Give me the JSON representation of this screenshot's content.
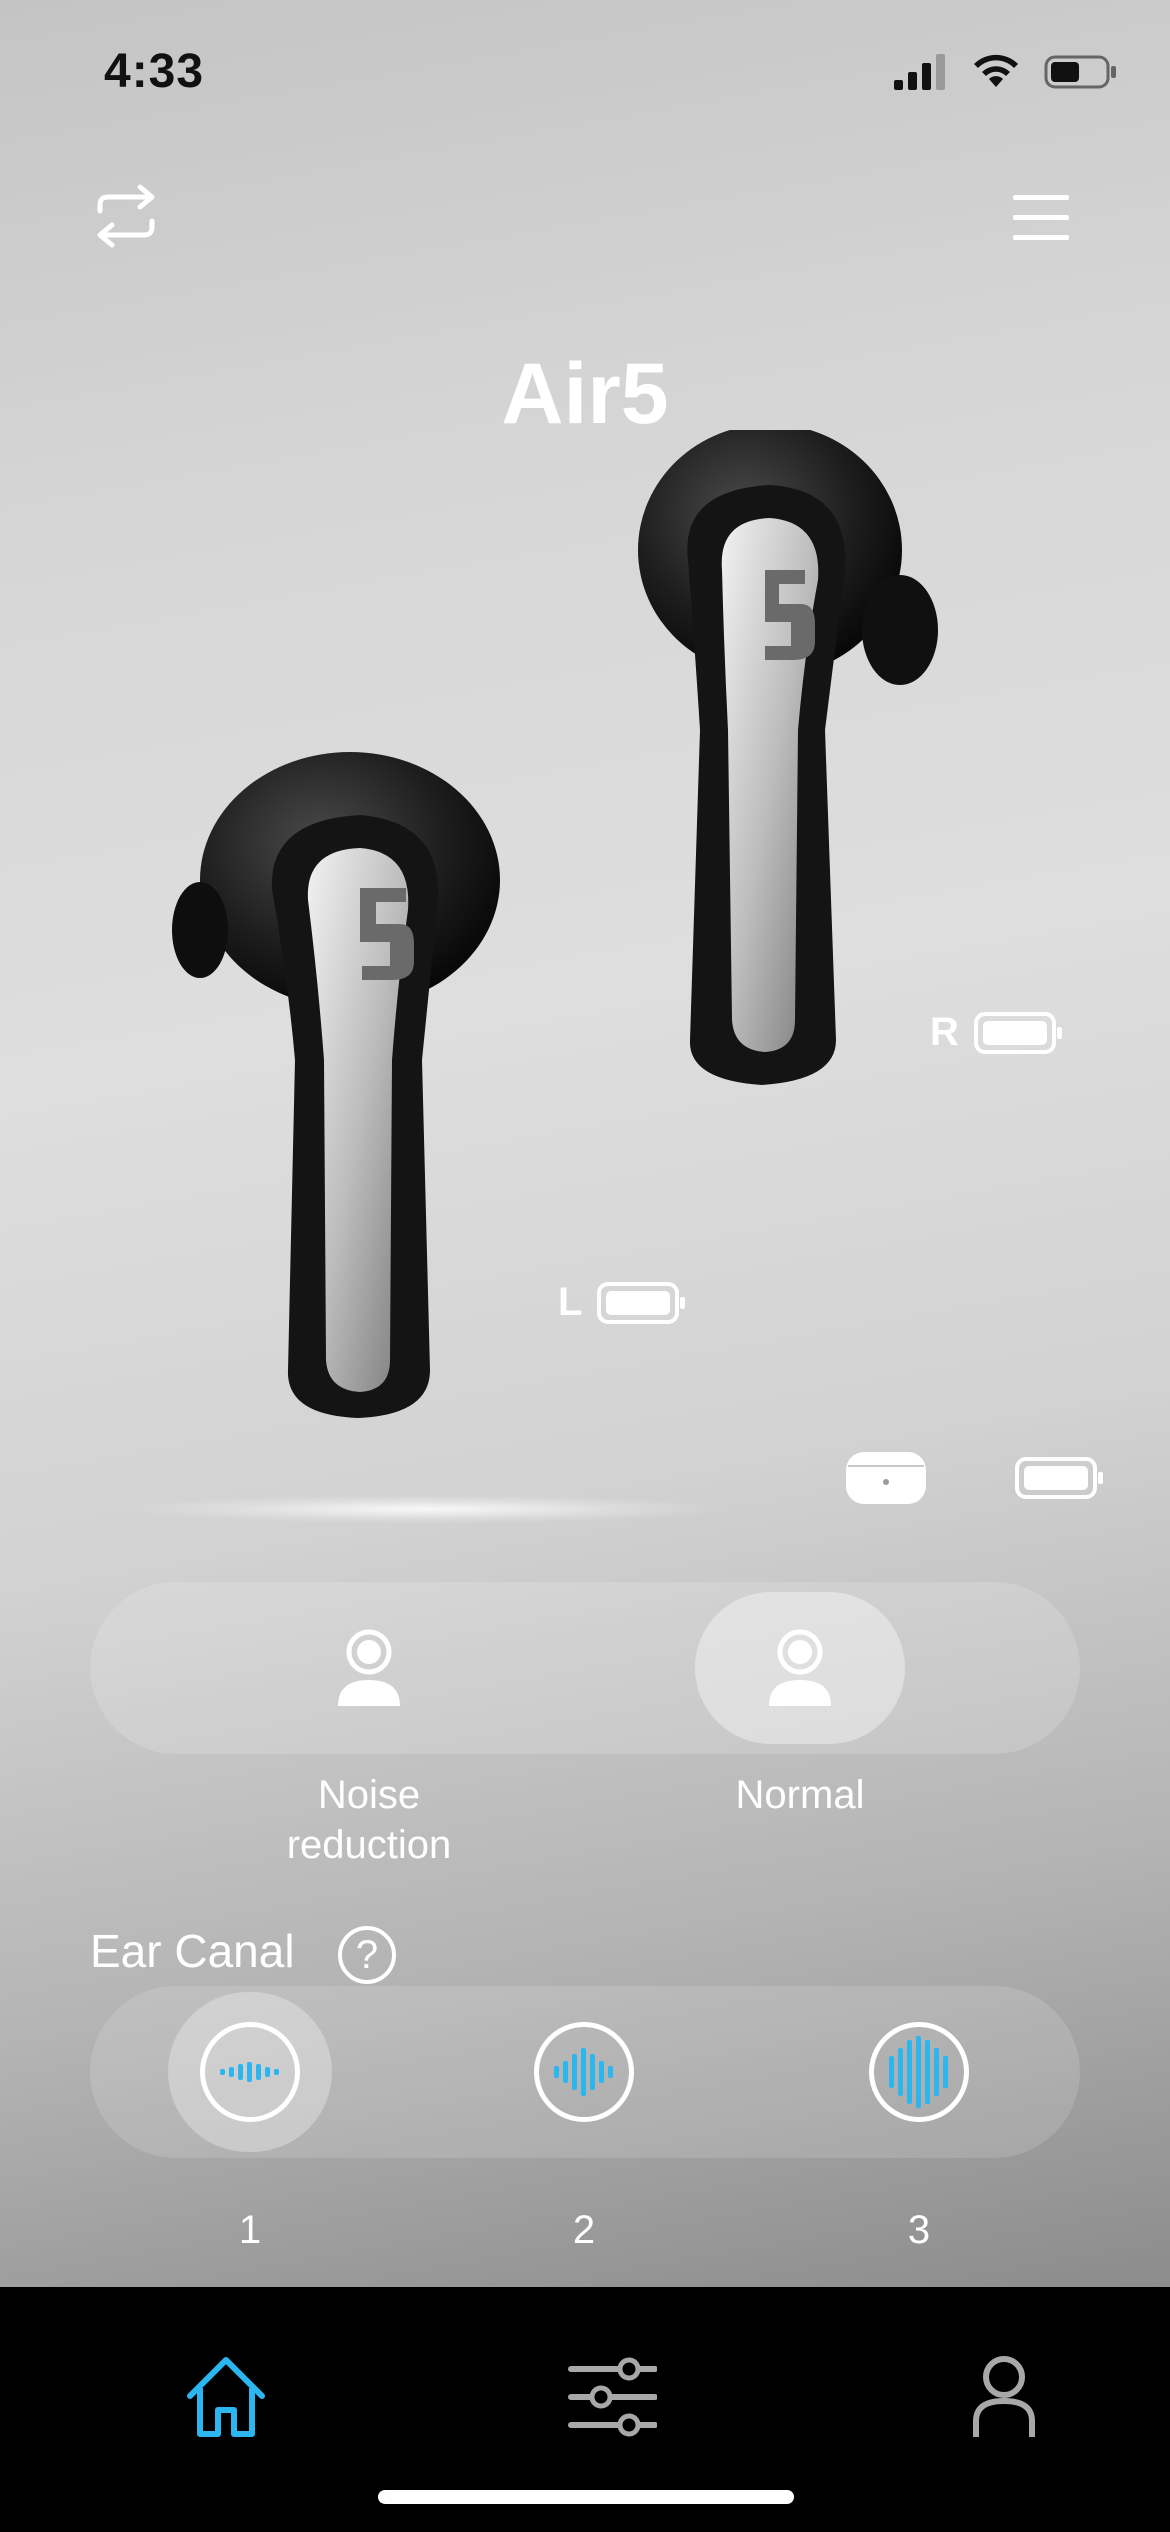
{
  "status_bar": {
    "time": "4:33"
  },
  "header": {
    "device_name": "Air5"
  },
  "battery": {
    "right_label": "R",
    "left_label": "L"
  },
  "modes": [
    {
      "label": "Noise\nreduction",
      "selected": false,
      "icon": "person-icon"
    },
    {
      "label": "Normal",
      "selected": true,
      "icon": "person-icon"
    }
  ],
  "ear_canal": {
    "label": "Ear Canal",
    "help": "?",
    "levels": [
      {
        "label": "1",
        "selected": true
      },
      {
        "label": "2",
        "selected": false
      },
      {
        "label": "3",
        "selected": false
      }
    ]
  },
  "tabs": [
    {
      "name": "home",
      "icon": "home-icon",
      "active": true
    },
    {
      "name": "equalizer",
      "icon": "sliders-icon",
      "active": false
    },
    {
      "name": "profile",
      "icon": "person-icon",
      "active": false
    }
  ],
  "colors": {
    "accent": "#2bb6f0",
    "tab_inactive": "#a8a8a8",
    "tabbar_bg": "#000000"
  }
}
